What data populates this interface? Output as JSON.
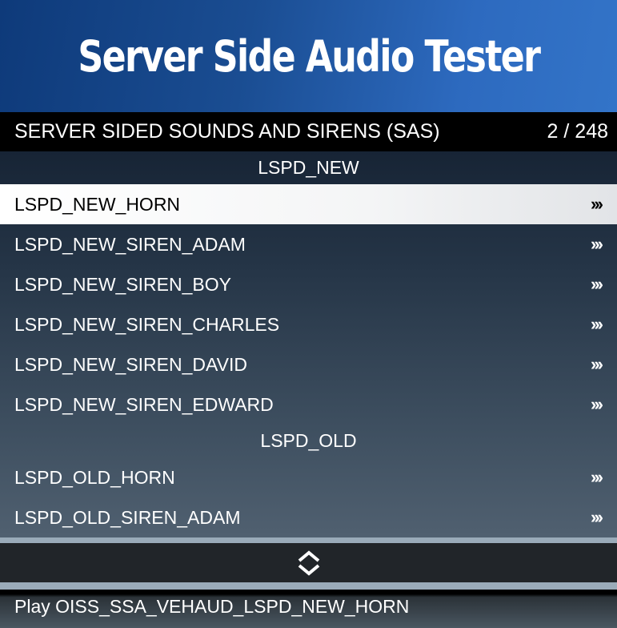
{
  "banner": {
    "title": "Server Side Audio Tester"
  },
  "subtitle": {
    "label": "SERVER SIDED SOUNDS AND SIRENS (SAS)",
    "counter": "2 / 248"
  },
  "sections": [
    {
      "label": "LSPD_NEW",
      "items": [
        {
          "label": "LSPD_NEW_HORN",
          "arrow": "›››",
          "selected": true
        },
        {
          "label": "LSPD_NEW_SIREN_ADAM",
          "arrow": "›››"
        },
        {
          "label": "LSPD_NEW_SIREN_BOY",
          "arrow": "›››"
        },
        {
          "label": "LSPD_NEW_SIREN_CHARLES",
          "arrow": "›››"
        },
        {
          "label": "LSPD_NEW_SIREN_DAVID",
          "arrow": "›››"
        },
        {
          "label": "LSPD_NEW_SIREN_EDWARD",
          "arrow": "›››"
        }
      ]
    },
    {
      "label": "LSPD_OLD",
      "items": [
        {
          "label": "LSPD_OLD_HORN",
          "arrow": "›››"
        },
        {
          "label": "LSPD_OLD_SIREN_ADAM",
          "arrow": "›››"
        }
      ]
    }
  ],
  "nav": {
    "icon": "up-down-chevron-icon"
  },
  "description": "Play OISS_SSA_VEHAUD_LSPD_NEW_HORN"
}
